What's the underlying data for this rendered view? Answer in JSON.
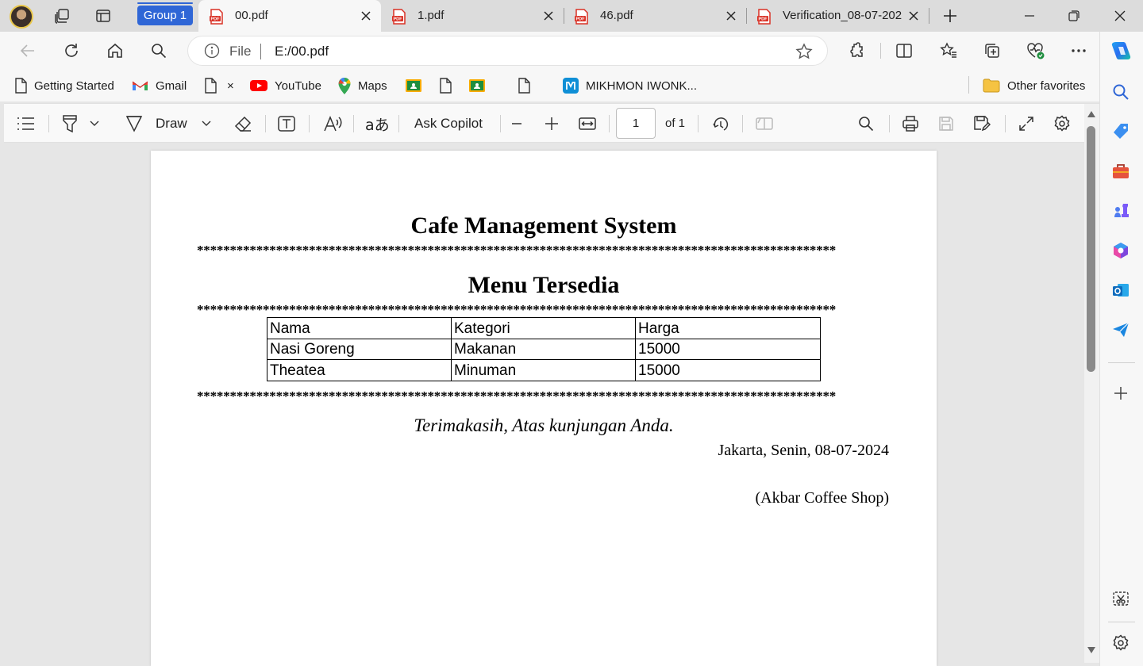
{
  "tabs": {
    "group_label": "Group 1",
    "items": [
      {
        "label": "00.pdf",
        "active": true
      },
      {
        "label": "1.pdf",
        "active": false
      },
      {
        "label": "46.pdf",
        "active": false
      },
      {
        "label": "Verification_08-07-202",
        "active": false
      }
    ]
  },
  "address": {
    "scheme_label": "File",
    "url": "E:/00.pdf"
  },
  "favorites": [
    {
      "label": "Getting Started",
      "icon": "page-icon"
    },
    {
      "label": "Gmail",
      "icon": "gmail-icon"
    },
    {
      "label": "×",
      "icon": "page-icon"
    },
    {
      "label": "YouTube",
      "icon": "youtube-icon"
    },
    {
      "label": "Maps",
      "icon": "maps-pin-icon"
    },
    {
      "label": "MIKHMON IWONK...",
      "icon": "mikhmon-icon"
    },
    {
      "label": "Other favorites",
      "icon": "folder-icon"
    }
  ],
  "pdf_toolbar": {
    "draw_label": "Draw",
    "ask_copilot_label": "Ask Copilot",
    "page_number": "1",
    "page_of": "of 1"
  },
  "document": {
    "title": "Cafe Management System",
    "separator": "************************************************************************************************************************************",
    "menu_title": "Menu Tersedia",
    "table": {
      "headers": [
        "Nama",
        "Kategori",
        "Harga"
      ],
      "rows": [
        [
          "Nasi Goreng",
          "Makanan",
          "15000"
        ],
        [
          "Theatea",
          "Minuman",
          "15000"
        ]
      ]
    },
    "thanks": "Terimakasih, Atas kunjungan Anda.",
    "date_line": "Jakarta, Senin, 08-07-2024",
    "shop_line": "(Akbar Coffee Shop)"
  },
  "colors": {
    "accent": "#2f66d6",
    "pdf_red": "#d93025"
  }
}
